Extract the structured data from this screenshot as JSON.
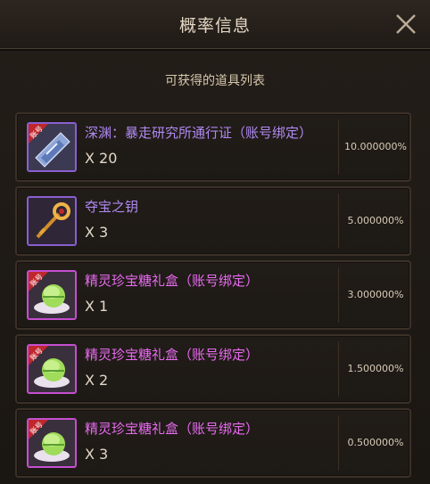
{
  "window": {
    "title": "概率信息"
  },
  "header": {
    "subtitle": "可获得的道具列表"
  },
  "items": [
    {
      "name": "深渊：暴走研究所通行证（账号绑定）",
      "quantity": "X 20",
      "probability": "10.000000%",
      "name_color": "#b089f2",
      "icon": "pass-ticket-icon",
      "bound_badge": "账号"
    },
    {
      "name": "夺宝之钥",
      "quantity": "X 3",
      "probability": "5.000000%",
      "name_color": "#b089f2",
      "icon": "golden-key-icon"
    },
    {
      "name": "精灵珍宝糖礼盒（账号绑定）",
      "quantity": "X 1",
      "probability": "3.000000%",
      "name_color": "#e86bf0",
      "icon": "candy-gift-box-icon",
      "bound_badge": "账号"
    },
    {
      "name": "精灵珍宝糖礼盒（账号绑定）",
      "quantity": "X 2",
      "probability": "1.500000%",
      "name_color": "#e86bf0",
      "icon": "candy-gift-box-icon",
      "bound_badge": "账号"
    },
    {
      "name": "精灵珍宝糖礼盒（账号绑定）",
      "quantity": "X 3",
      "probability": "0.500000%",
      "name_color": "#e86bf0",
      "icon": "candy-gift-box-icon",
      "bound_badge": "账号"
    }
  ]
}
